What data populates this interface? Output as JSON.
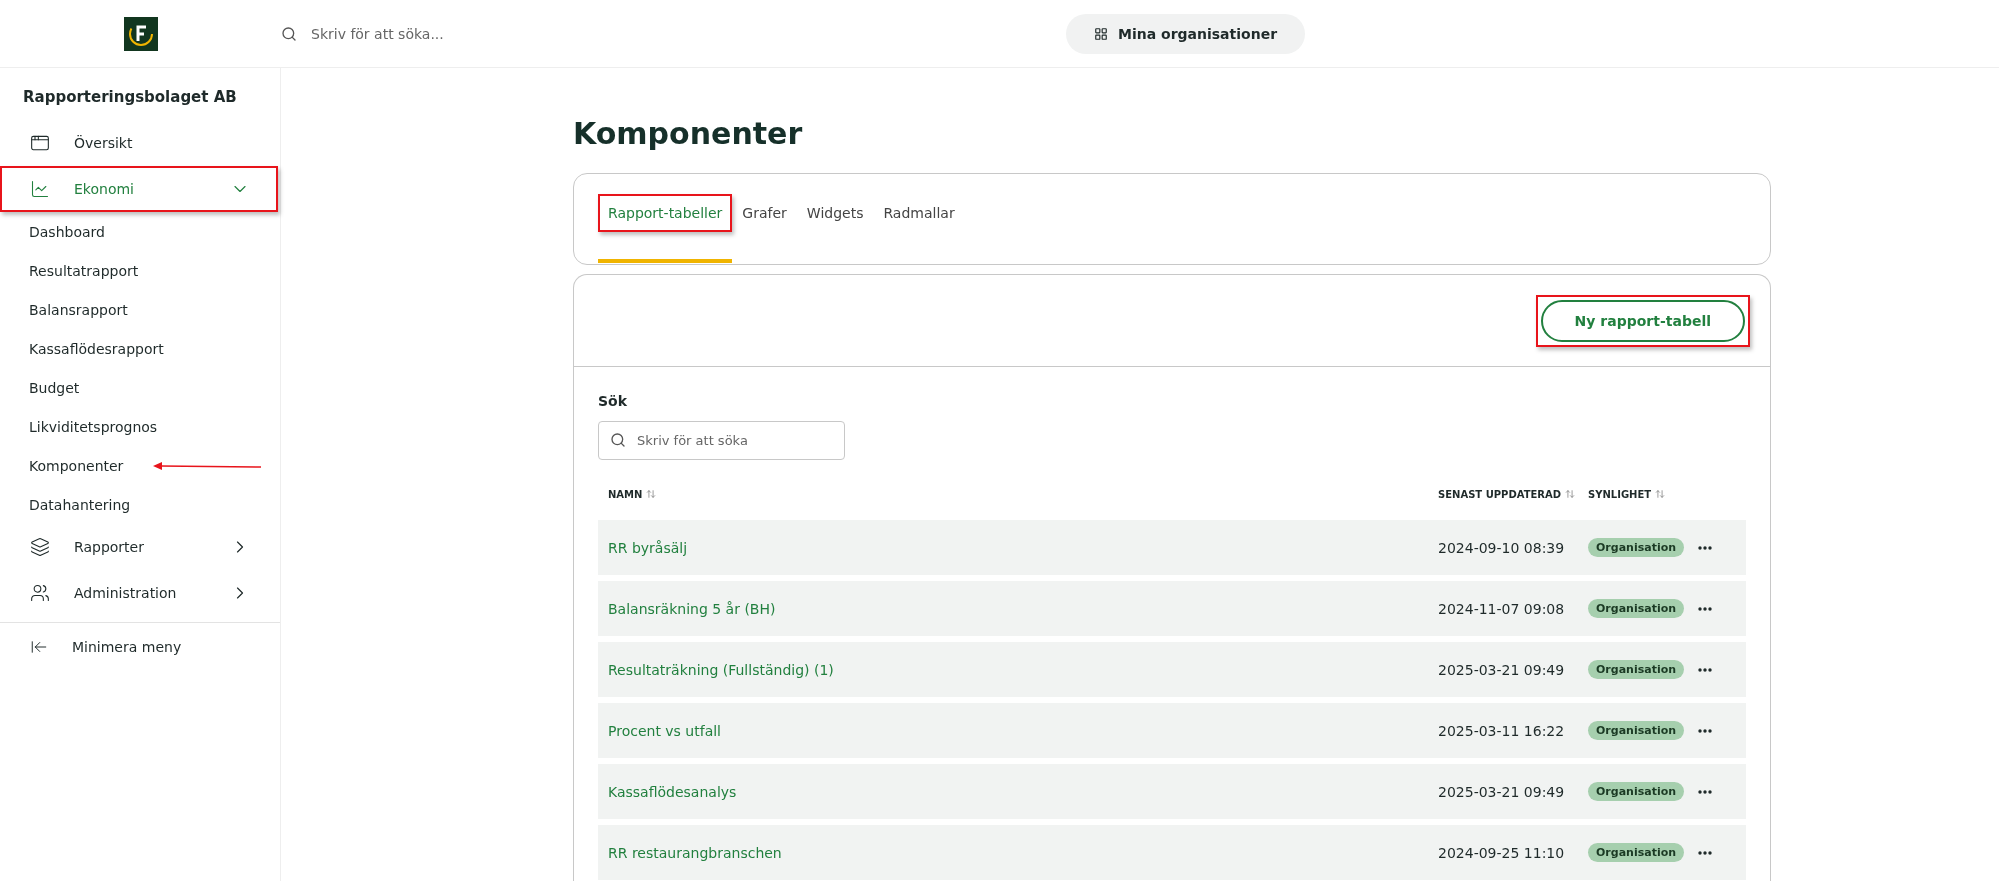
{
  "topbar": {
    "search_placeholder": "Skriv för att söka...",
    "org_button": "Mina organisationer"
  },
  "sidebar": {
    "company": "Rapporteringsbolaget AB",
    "items": [
      {
        "kind": "section",
        "label": "Översikt",
        "highlighted": false,
        "selected": false
      },
      {
        "kind": "section",
        "label": "Ekonomi",
        "expanded": true,
        "highlighted": true,
        "selected": true,
        "children": [
          {
            "label": "Dashboard",
            "annotated": false
          },
          {
            "label": "Resultatrapport",
            "annotated": false
          },
          {
            "label": "Balansrapport",
            "annotated": false
          },
          {
            "label": "Kassaflödesrapport",
            "annotated": false
          },
          {
            "label": "Budget",
            "annotated": false
          },
          {
            "label": "Likviditetsprognos",
            "annotated": false
          },
          {
            "label": "Komponenter",
            "annotated": true
          },
          {
            "label": "Datahantering",
            "annotated": false
          }
        ]
      },
      {
        "kind": "section",
        "label": "Rapporter",
        "expanded": false,
        "highlighted": false,
        "selected": false
      },
      {
        "kind": "section",
        "label": "Administration",
        "expanded": false,
        "highlighted": false,
        "selected": false
      }
    ],
    "minimize": "Minimera meny"
  },
  "page": {
    "title": "Komponenter",
    "tabs": [
      {
        "label": "Rapport-tabeller",
        "selected": true,
        "highlighted": true
      },
      {
        "label": "Grafer",
        "selected": false,
        "highlighted": false
      },
      {
        "label": "Widgets",
        "selected": false,
        "highlighted": false
      },
      {
        "label": "Radmallar",
        "selected": false,
        "highlighted": false
      }
    ],
    "new_button": {
      "label": "Ny rapport-tabell",
      "highlighted": true
    },
    "search": {
      "label": "Sök",
      "placeholder": "Skriv för att söka"
    },
    "table": {
      "columns": [
        "NAMN",
        "SENAST UPPDATERAD",
        "SYNLIGHET"
      ],
      "rows": [
        {
          "name": "RR byråsälj",
          "updated": "2024-09-10 08:39",
          "visibility": "Organisation"
        },
        {
          "name": "Balansräkning 5 år (BH)",
          "updated": "2024-11-07 09:08",
          "visibility": "Organisation"
        },
        {
          "name": "Resultaträkning (Fullständig) (1)",
          "updated": "2025-03-21 09:49",
          "visibility": "Organisation"
        },
        {
          "name": "Procent vs utfall",
          "updated": "2025-03-11 16:22",
          "visibility": "Organisation"
        },
        {
          "name": "Kassaflödesanalys",
          "updated": "2025-03-21 09:49",
          "visibility": "Organisation"
        },
        {
          "name": "RR restaurangbranschen",
          "updated": "2024-09-25 11:10",
          "visibility": "Organisation"
        }
      ]
    }
  }
}
